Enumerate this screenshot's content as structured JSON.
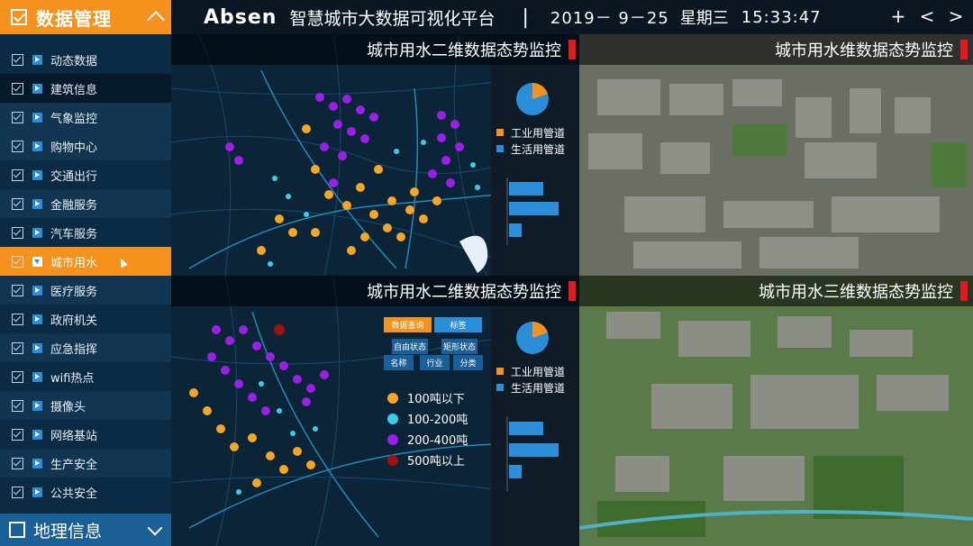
{
  "sidebar": {
    "header_title": "数据管理",
    "items": [
      {
        "label": "动态数据"
      },
      {
        "label": "建筑信息"
      },
      {
        "label": "气象监控"
      },
      {
        "label": "购物中心"
      },
      {
        "label": "交通出行"
      },
      {
        "label": "金融服务"
      },
      {
        "label": "汽车服务"
      },
      {
        "label": "城市用水"
      },
      {
        "label": "医疗服务"
      },
      {
        "label": "政府机关"
      },
      {
        "label": "应急指挥"
      },
      {
        "label": "wifi热点"
      },
      {
        "label": "摄像头"
      },
      {
        "label": "网络基站"
      },
      {
        "label": "生产安全"
      },
      {
        "label": "公共安全"
      }
    ],
    "active_item": "城市用水",
    "footer_title": "地理信息"
  },
  "topbar": {
    "logo": "Absen",
    "app_title": "智慧城市大数据可视化平台",
    "separator": "|",
    "date": "2019－ 9－25",
    "weekday": "星期三",
    "time": "15:33:47",
    "nav_plus": "+",
    "nav_prev": "<",
    "nav_next": ">"
  },
  "panels": {
    "top_left_title": "城市用水二维数据态势监控",
    "top_right_title": "城市用水维数据态势监控",
    "bottom_left_title": "城市用水二维数据态势监控",
    "bottom_right_title": "城市用水三维数据态势监控"
  },
  "pipe_legend": {
    "industrial": "工业用管道",
    "domestic": "生活用管道",
    "industrial_color": "#f5921e",
    "domestic_color": "#2a8fd8"
  },
  "filter_tabs": {
    "data_query": "数据查询",
    "tab2": "标签",
    "free_state": "自由状态",
    "shape_state": "矩形状态",
    "name": "名称",
    "industry": "行业",
    "category": "分类"
  },
  "size_legend": [
    {
      "label": "100吨以下",
      "color": "#f5a623"
    },
    {
      "label": "100-200吨",
      "color": "#35d0e6"
    },
    {
      "label": "200-400吨",
      "color": "#9b1fe8"
    },
    {
      "label": "500吨以上",
      "color": "#a01010"
    }
  ],
  "colors": {
    "accent": "#f5921e",
    "sidebar_bg": "#0b2a44",
    "footer_bg": "#1a5f96"
  }
}
